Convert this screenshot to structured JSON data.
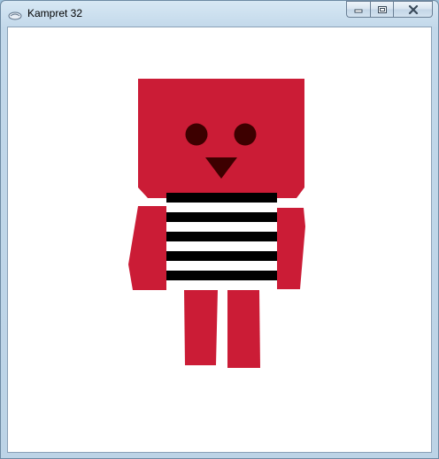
{
  "window": {
    "title": "Kampret 32",
    "buttons": {
      "minimize": "minimize-icon",
      "maximize": "restore-icon",
      "close": "close-icon"
    }
  },
  "colors": {
    "robot_red": "#cb1c36",
    "eye": "#3d0000",
    "nose": "#3d0000",
    "stripe_dark": "#000000",
    "stripe_light": "#ffffff",
    "canvas": "#ffffff"
  }
}
